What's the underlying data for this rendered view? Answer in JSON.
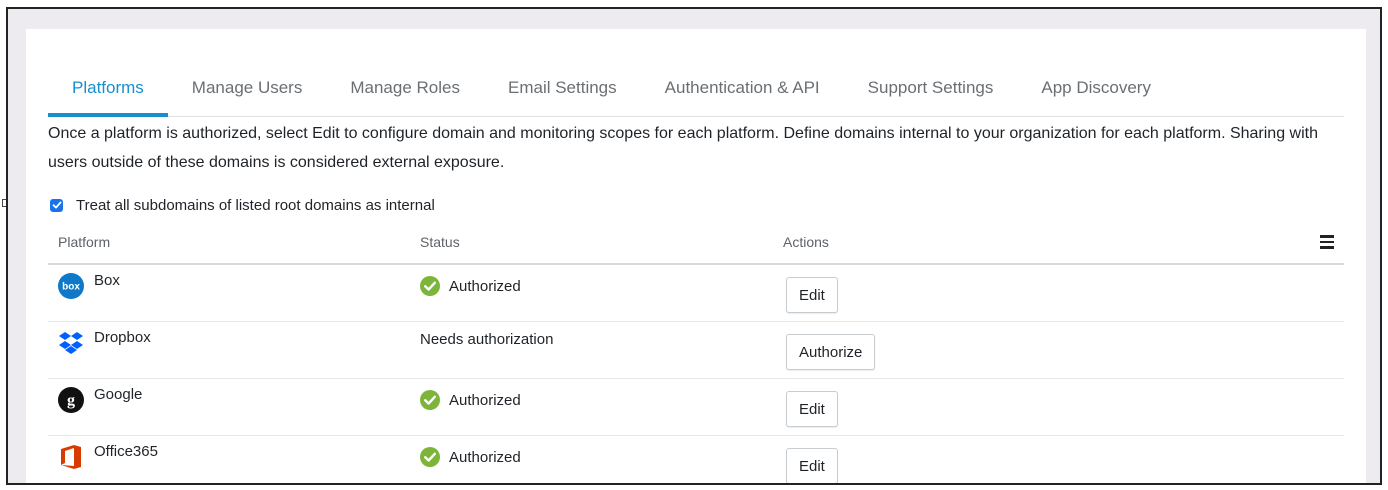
{
  "colors": {
    "accent": "#1a8fcf",
    "authorized_green": "#7db53a",
    "checkbox_blue": "#1a73e8",
    "office_red": "#d83b01",
    "box_blue": "#0e79c8",
    "dropbox_blue": "#0061fe"
  },
  "tabs": [
    {
      "label": "Platforms",
      "active": true
    },
    {
      "label": "Manage Users",
      "active": false
    },
    {
      "label": "Manage Roles",
      "active": false
    },
    {
      "label": "Email Settings",
      "active": false
    },
    {
      "label": "Authentication & API",
      "active": false
    },
    {
      "label": "Support Settings",
      "active": false
    },
    {
      "label": "App Discovery",
      "active": false
    }
  ],
  "description": "Once a platform is authorized, select Edit to configure domain and monitoring scopes for each platform. Define domains internal to your organization for each platform. Sharing with users outside of these domains is considered external exposure.",
  "subdomain_option": {
    "label": "Treat all subdomains of listed root domains as internal",
    "checked": true
  },
  "table": {
    "columns": [
      "Platform",
      "Status",
      "Actions"
    ],
    "menu_icon": "hamburger-menu-icon",
    "rows": [
      {
        "platform": "Box",
        "icon": "box-logo-icon",
        "status": "Authorized",
        "status_icon": "check-circle-icon",
        "action": "Edit"
      },
      {
        "platform": "Dropbox",
        "icon": "dropbox-logo-icon",
        "status": "Needs authorization",
        "status_icon": "",
        "action": "Authorize"
      },
      {
        "platform": "Google",
        "icon": "google-logo-icon",
        "status": "Authorized",
        "status_icon": "check-circle-icon",
        "action": "Edit"
      },
      {
        "platform": "Office365",
        "icon": "office365-logo-icon",
        "status": "Authorized",
        "status_icon": "check-circle-icon",
        "action": "Edit"
      }
    ]
  }
}
